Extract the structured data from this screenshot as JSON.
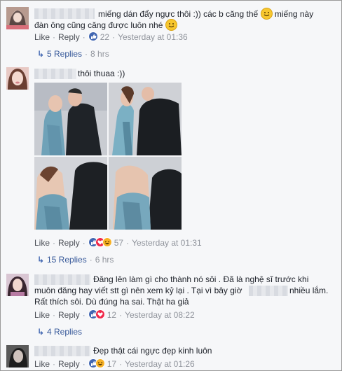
{
  "actions": {
    "like": "Like",
    "reply": "Reply",
    "sep": "·"
  },
  "comments": [
    {
      "line1": "miếng dán đẩy ngực thôi :)) các b căng thế",
      "line1b": "miếng này",
      "line2": "đàn ông cũng căng được luôn nhé",
      "reactions": "22",
      "time": "Yesterday at 01:36",
      "replies": "5 Replies",
      "replies_time": "8 hrs"
    },
    {
      "line1": "thôi thuaa :))",
      "reactions": "57",
      "time": "Yesterday at 01:31",
      "replies": "15 Replies",
      "replies_time": "6 hrs"
    },
    {
      "line1": "Đăng lên làm gì cho thành nó sôi . Đã là nghệ sĩ trước khi",
      "line2a": "muôn đăng hay viết stt gì nên xem kỷ lại . Tại vì bây giờ",
      "line2b": "nhiều lắm.",
      "line3": "Rất thích sôi. Dù đúng ha sai. Thật ha giả",
      "reactions": "12",
      "time": "Yesterday at 08:22",
      "replies": "4 Replies"
    },
    {
      "line1": "Đẹp thật cái ngực đẹp kinh luôn",
      "reactions": "17",
      "time": "Yesterday at 01:26"
    }
  ],
  "colors": {
    "link": "#365899",
    "like": "#4267b2",
    "love": "#f0284a",
    "haha": "#f7b125",
    "meta": "#90949c",
    "text": "#1d2129"
  },
  "icons": [
    "like-icon",
    "love-icon",
    "haha-icon",
    "smile-emoji-icon",
    "reply-arrow-icon"
  ]
}
